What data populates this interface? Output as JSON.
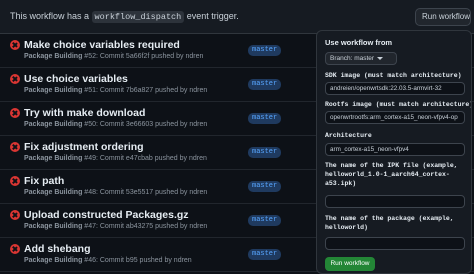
{
  "banner": {
    "text_before": "This workflow has a ",
    "code": "workflow_dispatch",
    "text_after": " event trigger.",
    "run_button": "Run workflow"
  },
  "runs": [
    {
      "title": "Make choice variables required",
      "workflow": "Package Building",
      "detail": " #52: Commit 5a66f2f pushed by ndren",
      "branch": "master",
      "status": "failure"
    },
    {
      "title": "Use choice variables",
      "workflow": "Package Building",
      "detail": " #51: Commit 7b6a827 pushed by ndren",
      "branch": "master",
      "status": "failure"
    },
    {
      "title": "Try with make download",
      "workflow": "Package Building",
      "detail": " #50: Commit 3e66603 pushed by ndren",
      "branch": "master",
      "status": "failure"
    },
    {
      "title": "Fix adjustment ordering",
      "workflow": "Package Building",
      "detail": " #49: Commit e47cbab pushed by ndren",
      "branch": "master",
      "status": "failure"
    },
    {
      "title": "Fix path",
      "workflow": "Package Building",
      "detail": " #48: Commit 53e5517 pushed by ndren",
      "branch": "master",
      "status": "failure"
    },
    {
      "title": "Upload constructed Packages.gz",
      "workflow": "Package Building",
      "detail": " #47: Commit ab43275 pushed by ndren",
      "branch": "master",
      "status": "failure"
    },
    {
      "title": "Add shebang",
      "workflow": "Package Building",
      "detail": " #46: Commit b95 pushed by ndren",
      "branch": "master",
      "status": "failure"
    }
  ],
  "panel": {
    "title": "Use workflow from",
    "branch_select": "Branch: master",
    "fields": [
      {
        "label": "SDK image (must match architecture)",
        "value": "andreien/openwrtsdk:22.03.5-armvirt-32"
      },
      {
        "label": "Rootfs image (must match architecture)",
        "value": "openwrtrootfs:arm_cortex-a15_neon-vfpv4-op"
      },
      {
        "label": "Architecture",
        "value": "arm_cortex-a15_neon-vfpv4"
      },
      {
        "label": "The name of the IPK file (example, helloworld_1.0-1_aarch64_cortex-a53.ipk)",
        "value": ""
      },
      {
        "label": "The name of the package (example, helloworld)",
        "value": ""
      }
    ],
    "submit": "Run workflow"
  },
  "colors": {
    "failure": "#da3633",
    "accent": "#238636",
    "branch": "#58a6ff"
  }
}
